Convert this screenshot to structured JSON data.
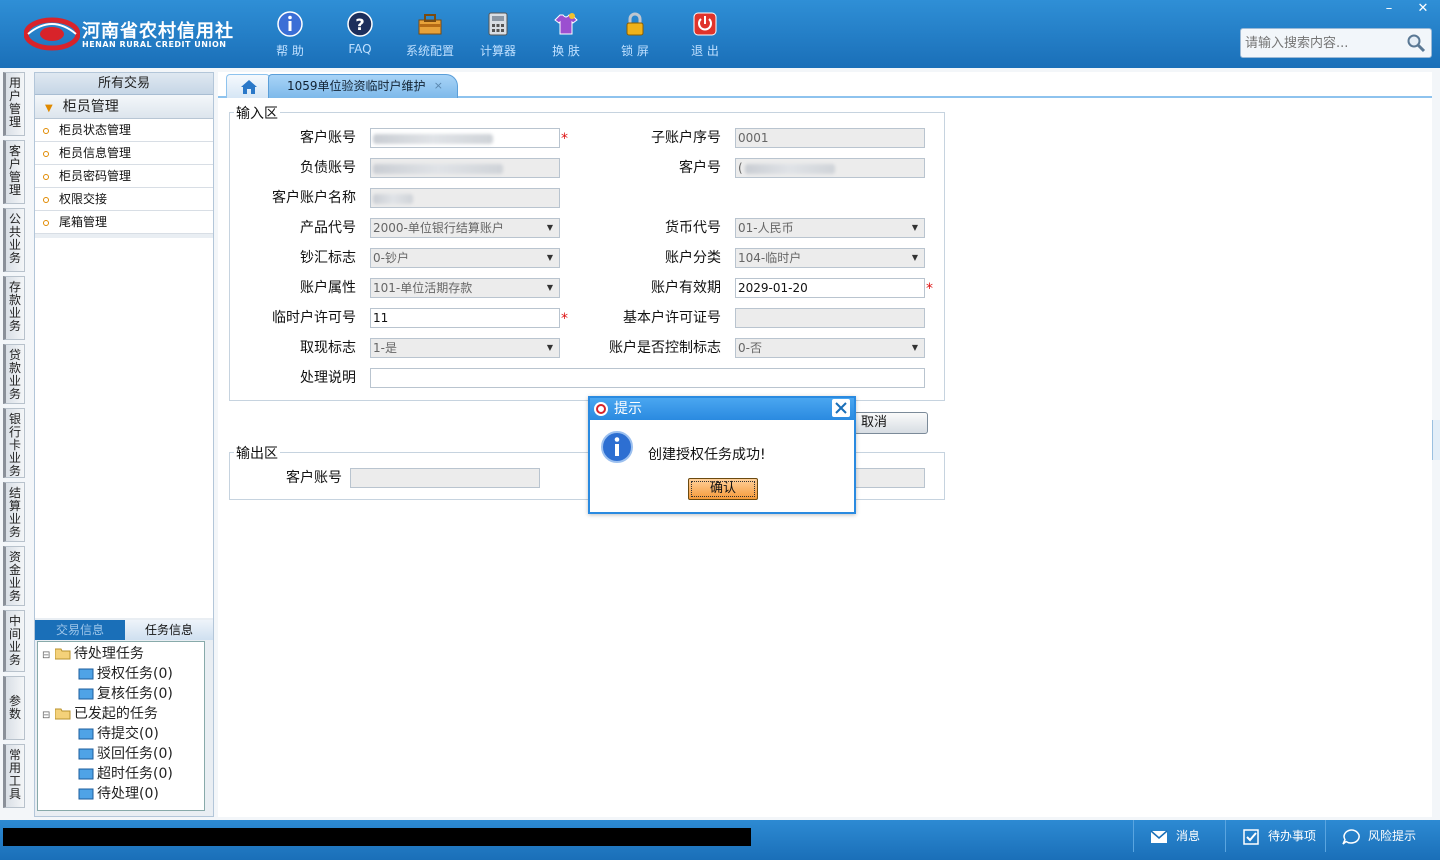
{
  "brand": {
    "cn": "河南省农村信用社",
    "en": "HENAN RURAL CREDIT UNION"
  },
  "toolbar": [
    {
      "label": "帮 助",
      "icon": "info-icon"
    },
    {
      "label": "FAQ",
      "icon": "question-icon"
    },
    {
      "label": "系统配置",
      "icon": "toolbox-icon"
    },
    {
      "label": "计算器",
      "icon": "calculator-icon"
    },
    {
      "label": "换 肤",
      "icon": "shirt-icon"
    },
    {
      "label": "锁 屏",
      "icon": "lock-icon"
    },
    {
      "label": "退 出",
      "icon": "power-icon"
    }
  ],
  "window": {
    "minimize": "–",
    "close": "✕"
  },
  "search": {
    "placeholder": "请输入搜索内容..."
  },
  "vtabs": [
    "用户管理",
    "客户管理",
    "公共业务",
    "存款业务",
    "贷款业务",
    "银行卡业务",
    "结算业务",
    "资金业务",
    "中间业务",
    "参数",
    "常用工具"
  ],
  "leftpanel": {
    "header": "所有交易",
    "group": "柜员管理",
    "items": [
      "柜员状态管理",
      "柜员信息管理",
      "柜员密码管理",
      "权限交接",
      "尾箱管理"
    ],
    "tabs": [
      "交易信息",
      "任务信息"
    ],
    "tree": {
      "pending": "待处理任务",
      "auth": "授权任务(0)",
      "review": "复核任务(0)",
      "initiated": "已发起的任务",
      "tosubmit": "待提交(0)",
      "rejected": "驳回任务(0)",
      "timeout": "超时任务(0)",
      "todo": "待处理(0)"
    }
  },
  "tabs": {
    "current": "1059单位验资临时户维护",
    "close": "×"
  },
  "input": {
    "legend": "输入区",
    "cust_account_label": "客户账号",
    "sub_seq_label": "子账户序号",
    "sub_seq_value": "0001",
    "debt_account_label": "负债账号",
    "cust_no_label": "客户号",
    "cust_no_prefix": "(",
    "account_name_label": "客户账户名称",
    "product_label": "产品代号",
    "product_value": "2000-单位银行结算账户",
    "currency_label": "货币代号",
    "currency_value": "01-人民币",
    "cash_flag_label": "钞汇标志",
    "cash_flag_value": "0-钞户",
    "acct_class_label": "账户分类",
    "acct_class_value": "104-临时户",
    "acct_attr_label": "账户属性",
    "acct_attr_value": "101-单位活期存款",
    "valid_label": "账户有效期",
    "valid_value": "2029-01-20",
    "temp_permit_label": "临时户许可号",
    "temp_permit_value": "11",
    "basic_permit_label": "基本户许可证号",
    "withdraw_label": "取现标志",
    "withdraw_value": "1-是",
    "control_label": "账户是否控制标志",
    "control_value": "0-否",
    "remark_label": "处理说明",
    "required": "*",
    "cancel": "取消"
  },
  "output": {
    "legend": "输出区",
    "cust_account_label": "客户账号"
  },
  "dialog": {
    "title": "提示",
    "message": "创建授权任务成功!",
    "ok": "确认"
  },
  "status": [
    {
      "label": "消息",
      "icon": "mail-icon"
    },
    {
      "label": "待办事项",
      "icon": "checkbox-icon"
    },
    {
      "label": "风险提示",
      "icon": "chat-icon"
    }
  ],
  "colors": {
    "topbar": "#1a6fb8",
    "accent": "#2a8ae0",
    "required": "#d11111",
    "ok_button": "#f59a3a"
  }
}
